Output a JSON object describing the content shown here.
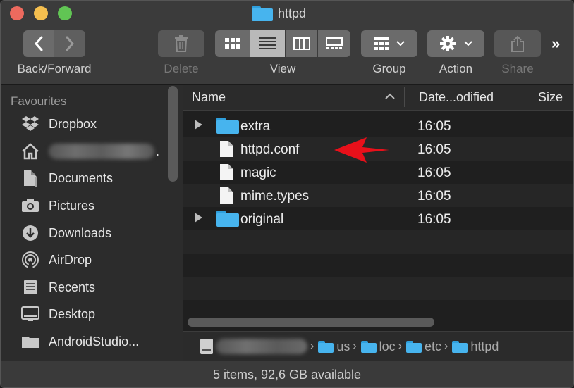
{
  "window": {
    "title": "httpd"
  },
  "toolbar": {
    "back_forward_label": "Back/Forward",
    "delete_label": "Delete",
    "view_label": "View",
    "group_label": "Group",
    "action_label": "Action",
    "share_label": "Share",
    "more_glyph": "»"
  },
  "sidebar": {
    "heading": "Favourites",
    "items": [
      {
        "label": "Dropbox",
        "icon": "dropbox-icon"
      },
      {
        "label": "",
        "icon": "home-icon"
      },
      {
        "label": "Documents",
        "icon": "documents-icon"
      },
      {
        "label": "Pictures",
        "icon": "camera-icon"
      },
      {
        "label": "Downloads",
        "icon": "download-icon"
      },
      {
        "label": "AirDrop",
        "icon": "airdrop-icon"
      },
      {
        "label": "Recents",
        "icon": "recents-icon"
      },
      {
        "label": "Desktop",
        "icon": "desktop-icon"
      },
      {
        "label": "AndroidStudio...",
        "icon": "folder-icon"
      }
    ]
  },
  "columns": {
    "name": "Name",
    "date": "Date...odified",
    "size": "Size"
  },
  "files": [
    {
      "name": "extra",
      "date": "16:05",
      "type": "folder"
    },
    {
      "name": "httpd.conf",
      "date": "16:05",
      "type": "file"
    },
    {
      "name": "magic",
      "date": "16:05",
      "type": "file"
    },
    {
      "name": "mime.types",
      "date": "16:05",
      "type": "file"
    },
    {
      "name": "original",
      "date": "16:05",
      "type": "folder"
    }
  ],
  "pathbar": {
    "segments": [
      "us",
      "loc",
      "etc",
      "httpd"
    ],
    "separator": "›"
  },
  "status": {
    "text": "5 items, 92,6 GB available"
  },
  "colors": {
    "accent_folder": "#47b4ee",
    "annotation_arrow": "#e8101a"
  }
}
